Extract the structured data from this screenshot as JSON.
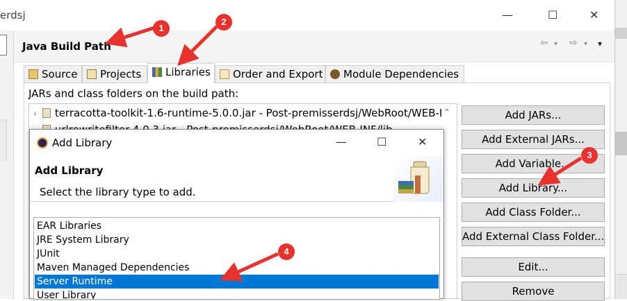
{
  "window": {
    "title_fragment": "erdsj",
    "minimize_glyph": "—",
    "maximize_glyph": "☐",
    "close_glyph": "✕"
  },
  "page": {
    "title": "Java Build Path",
    "nav_back_glyph": "⇦",
    "nav_forward_glyph": "⇨",
    "nav_menu_glyph": "▾"
  },
  "tabs": [
    {
      "label": "Source",
      "icon": "source-folder-icon",
      "active": false
    },
    {
      "label": "Projects",
      "icon": "projects-icon",
      "active": false
    },
    {
      "label": "Libraries",
      "icon": "libraries-icon",
      "active": true
    },
    {
      "label": "Order and Export",
      "icon": "order-export-icon",
      "active": false
    },
    {
      "label": "Module Dependencies",
      "icon": "module-dependencies-icon",
      "active": false
    }
  ],
  "build_path": {
    "label": "JARs and class folders on the build path:",
    "entries": [
      {
        "text": "terracotta-toolkit-1.6-runtime-5.0.0.jar - Post-premisserdsj/WebRoot/WEB-I"
      },
      {
        "text": "urlrewritefilter-4.0.3.jar - Post-premisserdsj/WebRoot/WEB-INF/lib"
      }
    ]
  },
  "buttons": {
    "add_jars": "Add JARs...",
    "add_external_jars": "Add External JARs...",
    "add_variable": "Add Variable...",
    "add_library": "Add Library...",
    "add_class_folder": "Add Class Folder...",
    "add_external_class_folder": "Add External Class Folder...",
    "edit": "Edit...",
    "remove": "Remove"
  },
  "dialog": {
    "title": "Add Library",
    "heading": "Add Library",
    "subtitle": "Select the library type to add.",
    "library_types": [
      {
        "label": "EAR Libraries",
        "selected": false
      },
      {
        "label": "JRE System Library",
        "selected": false
      },
      {
        "label": "JUnit",
        "selected": false
      },
      {
        "label": "Maven Managed Dependencies",
        "selected": false
      },
      {
        "label": "Server Runtime",
        "selected": true
      },
      {
        "label": "User Library",
        "selected": false
      }
    ]
  },
  "annotations": [
    {
      "number": "1"
    },
    {
      "number": "2"
    },
    {
      "number": "3"
    },
    {
      "number": "4"
    }
  ],
  "colors": {
    "annotation_red": "#e8322b",
    "selection_blue": "#0078d7"
  }
}
